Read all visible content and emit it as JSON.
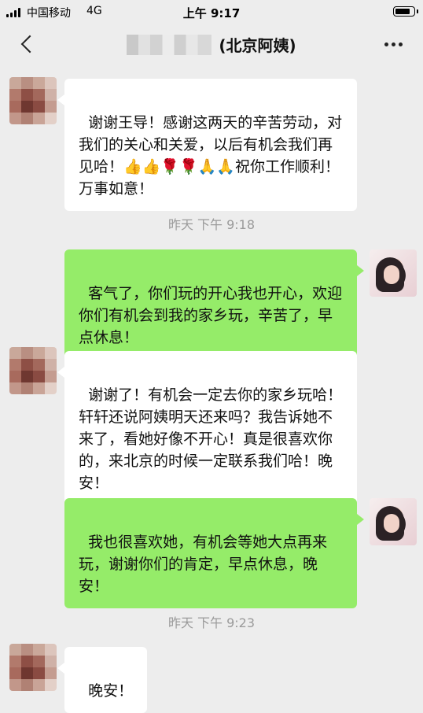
{
  "status_bar": {
    "carrier": "中国移动",
    "network": "4G",
    "time": "上午 9:17"
  },
  "nav": {
    "title": "(北京阿姨)"
  },
  "messages": [
    {
      "sender": "other",
      "text": "谢谢王导！感谢这两天的辛苦劳动，对我们的关心和关爱，以后有机会我们再见哈！👍👍🌹🌹🙏🙏祝你工作顺利！万事如意！"
    },
    {
      "type": "timestamp",
      "text": "昨天 下午 9:18"
    },
    {
      "sender": "me",
      "text": "客气了，你们玩的开心我也开心，欢迎你们有机会到我的家乡玩，辛苦了，早点休息！"
    },
    {
      "sender": "other",
      "text": "谢谢了！有机会一定去你的家乡玩哈！轩轩还说阿姨明天还来吗？我告诉她不来了，看她好像不开心！真是很喜欢你的，来北京的时候一定联系我们哈！晚安！"
    },
    {
      "sender": "me",
      "text": "我也很喜欢她，有机会等她大点再来玩，谢谢你们的肯定，早点休息，晚安！"
    },
    {
      "type": "timestamp",
      "text": "昨天 下午 9:23"
    },
    {
      "sender": "other",
      "text": "晚安！"
    }
  ],
  "colors": {
    "background": "#ededed",
    "bubble_out": "#95ec69",
    "bubble_in": "#ffffff",
    "timestamp": "#9a9a9a"
  }
}
